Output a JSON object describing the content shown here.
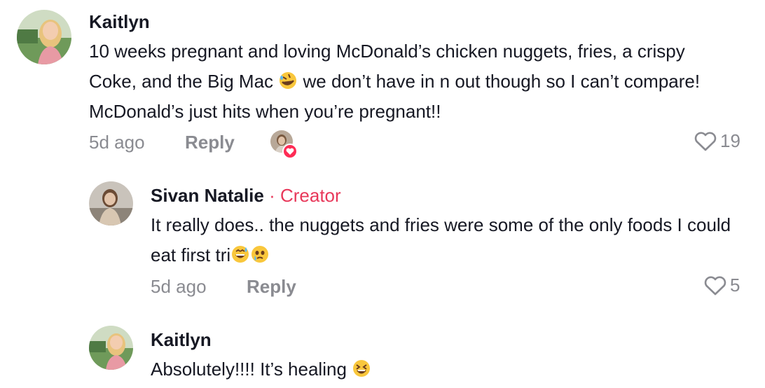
{
  "comments": [
    {
      "author": "Kaitlyn",
      "text_before_emoji": "10 weeks pregnant and loving McDonald’s chicken nuggets, fries, a crispy Coke, and the Big Mac",
      "emoji1": "rolling-on-floor-laughing",
      "text_after_emoji": "we don’t have in n out though so I can’t compare! McDonald’s just hits when you’re pregnant!!",
      "time": "5d ago",
      "reply_label": "Reply",
      "likes": "19"
    },
    {
      "author": "Sivan Natalie",
      "badge": " · Creator",
      "text": "It really does.. the nuggets and fries were some of the only foods I could eat first tri",
      "emoji1": "grinning-sweat",
      "emoji2": "face-holding-back-tears",
      "time": "5d ago",
      "reply_label": "Reply",
      "likes": "5"
    },
    {
      "author": "Kaitlyn",
      "text": "Absolutely!!!! It’s healing ",
      "emoji1": "grinning-squinting",
      "time": "",
      "reply_label": "",
      "likes": ""
    }
  ],
  "colors": {
    "creator": "#e8385a",
    "meta": "#8a8b91",
    "like_badge": "#fe2c55"
  }
}
